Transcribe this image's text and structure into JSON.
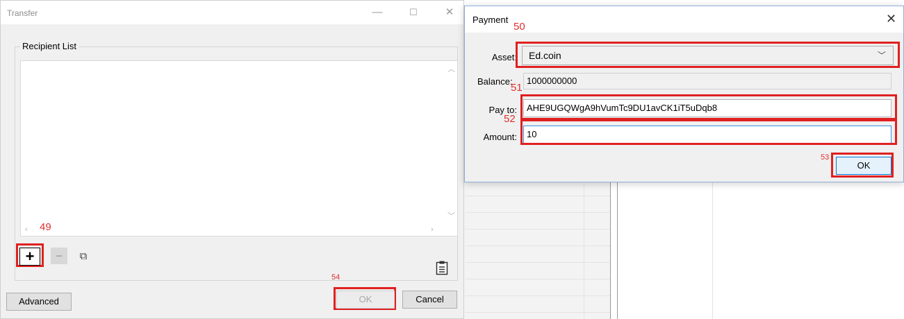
{
  "transfer": {
    "title": "Transfer",
    "controls": {
      "minimize": "—",
      "maximize": "☐",
      "close": "✕"
    },
    "recipient_list_label": "Recipient List",
    "add_button_icon": "+",
    "remove_button_icon": "−",
    "duplicate_icon": "⧉",
    "paste_icon": "📋",
    "advanced_label": "Advanced",
    "ok_label": "OK",
    "cancel_label": "Cancel",
    "ok_enabled": false
  },
  "payment": {
    "title": "Payment",
    "close": "✕",
    "asset_label": "Asset:",
    "asset_value": "Ed.coin",
    "balance_label": "Balance:",
    "balance_value": "1000000000",
    "payto_label": "Pay to:",
    "payto_value": "AHE9UGQWgA9hVumTc9DU1avCK1iT5uDqb8",
    "amount_label": "Amount:",
    "amount_value": "10",
    "ok_label": "OK"
  },
  "annotations": {
    "n49": "49",
    "n50": "50",
    "n51": "51",
    "n52": "52",
    "n53": "53",
    "n54": "54",
    "highlight_color": "#e02020"
  },
  "icons": {
    "add": "plus-icon",
    "remove": "minus-icon",
    "duplicate": "duplicate-icon",
    "paste": "clipboard-icon",
    "dropdown": "chevron-down-icon"
  }
}
